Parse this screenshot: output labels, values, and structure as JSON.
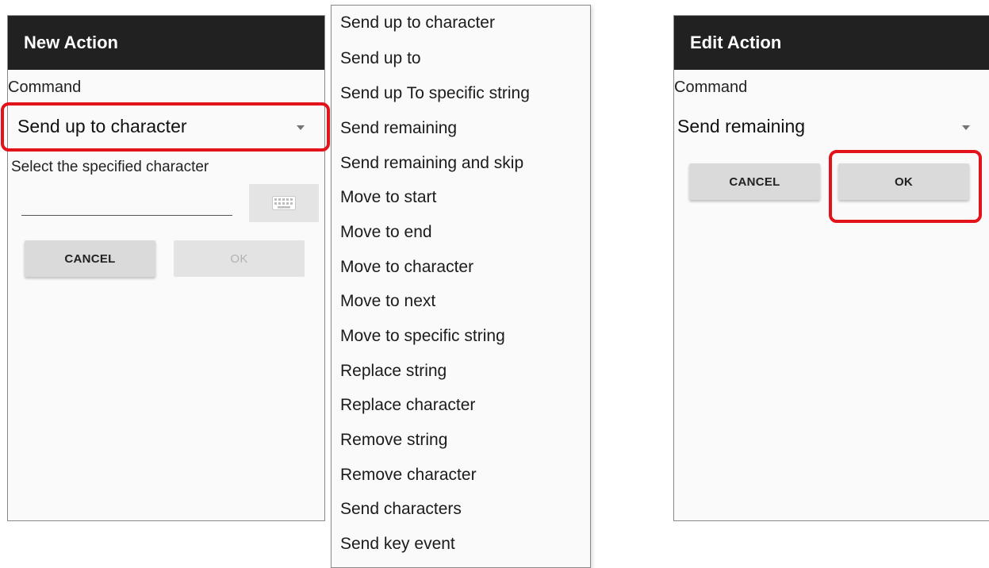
{
  "new_action": {
    "title": "New Action",
    "command_label": "Command",
    "selected_command": "Send up to character",
    "field_label": "Select the specified character",
    "char_input_value": "",
    "cancel_label": "CANCEL",
    "ok_label": "OK"
  },
  "dropdown": {
    "items": [
      "Send up to character",
      "Send up to",
      "Send up To specific string",
      "Send remaining",
      "Send remaining and skip",
      "Move to start",
      "Move to end",
      "Move to character",
      "Move to next",
      "Move to specific string",
      "Replace string",
      "Replace character",
      "Remove string",
      "Remove character",
      "Send characters",
      "Send key event"
    ]
  },
  "edit_action": {
    "title": "Edit Action",
    "command_label": "Command",
    "selected_command": "Send remaining",
    "cancel_label": "CANCEL",
    "ok_label": "OK"
  },
  "colors": {
    "titlebar": "#212121",
    "highlight": "#e3131b",
    "panel_bg": "#fafafa",
    "button_bg": "#dadada"
  }
}
